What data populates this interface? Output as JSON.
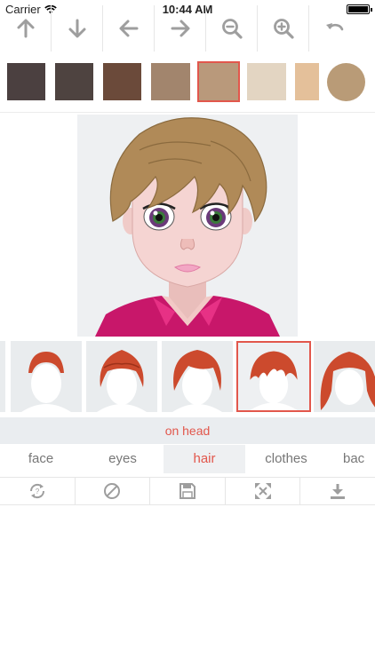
{
  "status_bar": {
    "carrier": "Carrier",
    "time": "10:44 AM"
  },
  "toolbar": {
    "tools": [
      {
        "name": "arrow-up-icon"
      },
      {
        "name": "arrow-down-icon"
      },
      {
        "name": "arrow-left-icon"
      },
      {
        "name": "arrow-right-icon"
      },
      {
        "name": "zoom-out-icon"
      },
      {
        "name": "zoom-in-icon"
      },
      {
        "name": "undo-icon"
      }
    ],
    "icon_color": "#9e9e9e"
  },
  "color_swatches": {
    "colors": [
      "#4b4040",
      "#4e4340",
      "#6b4a3a",
      "#a2856d",
      "#b9997b",
      "#e3d5c2",
      "#e4c09a",
      "#b99b77"
    ],
    "selected_index": 4
  },
  "hair_options": {
    "selected_index": 4,
    "hair_color": "#cc4a2d"
  },
  "position_label": "on head",
  "tabs": {
    "items": [
      "face",
      "eyes",
      "hair",
      "clothes",
      "bac"
    ],
    "active_index": 2
  },
  "actions": {
    "items": [
      {
        "name": "randomize-icon"
      },
      {
        "name": "clear-icon"
      },
      {
        "name": "save-icon"
      },
      {
        "name": "fullscreen-icon"
      },
      {
        "name": "download-icon"
      }
    ]
  },
  "theme": {
    "accent": "#e2574c",
    "panel_bg": "#eaedf0"
  }
}
